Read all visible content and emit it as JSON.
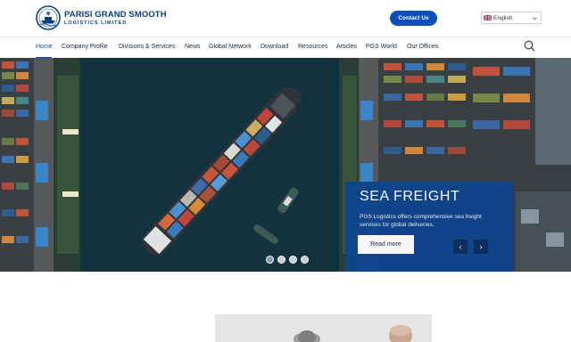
{
  "brand": {
    "name_line1": "PARISI GRAND SMOOTH",
    "name_line2": "LOGISTICS LIMITED",
    "colors": {
      "primary": "#0c4fb8",
      "navy": "#0a3f7a",
      "card": "#0f458d"
    }
  },
  "header": {
    "contact_label": "Contact Us",
    "language": {
      "selected": "English",
      "icon": "uk-flag-icon"
    }
  },
  "nav": {
    "items": [
      {
        "label": "Home",
        "active": true
      },
      {
        "label": "Company Profile"
      },
      {
        "label": "Divisions & Services"
      },
      {
        "label": "News"
      },
      {
        "label": "Global Network"
      },
      {
        "label": "Download"
      },
      {
        "label": "Resources"
      },
      {
        "label": "Articles"
      },
      {
        "label": "PGS World"
      },
      {
        "label": "Our Offices"
      }
    ],
    "search_icon": "search-icon"
  },
  "hero": {
    "slide": {
      "title": "SEA FREIGHT",
      "description": "PGS Logistics offers comprehensive sea freight services for global deliveries.",
      "button_label": "Read more"
    },
    "prev_symbol": "‹",
    "next_symbol": "›",
    "slide_count": 4,
    "active_slide": 1
  }
}
